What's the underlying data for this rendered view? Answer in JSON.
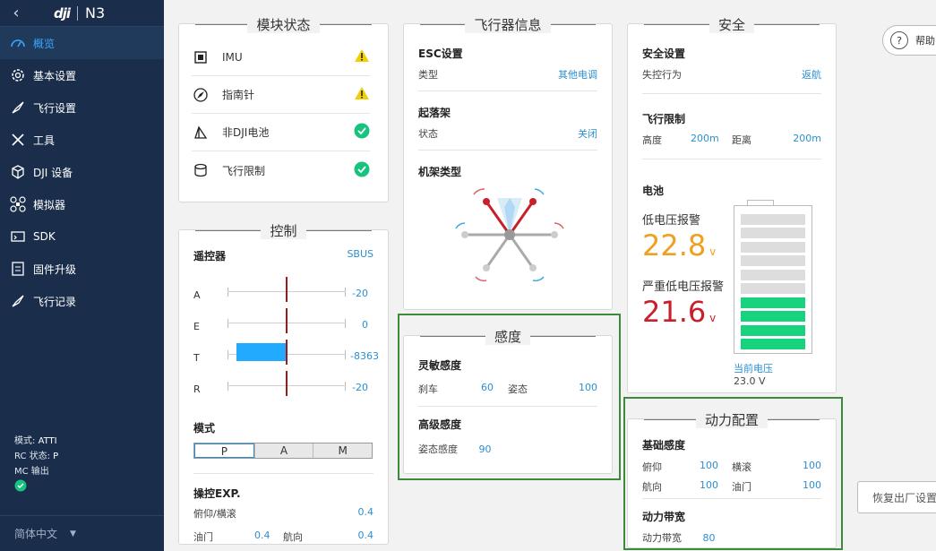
{
  "app": {
    "logo": "dji",
    "model": "N3",
    "back_glyph": "‹"
  },
  "nav": [
    {
      "label": "概览",
      "icon": "gauge-icon",
      "active": true
    },
    {
      "label": "基本设置",
      "icon": "gear-icon"
    },
    {
      "label": "飞行设置",
      "icon": "rocket-icon"
    },
    {
      "label": "工具",
      "icon": "tools-icon"
    },
    {
      "label": "DJI 设备",
      "icon": "cube-icon"
    },
    {
      "label": "模拟器",
      "icon": "drone-icon"
    },
    {
      "label": "SDK",
      "icon": "sdk-icon"
    },
    {
      "label": "固件升级",
      "icon": "firmware-icon"
    },
    {
      "label": "飞行记录",
      "icon": "log-icon"
    }
  ],
  "status": {
    "mode_label": "模式:",
    "mode_value": "ATTI",
    "rc_label": "RC 状态:",
    "rc_value": "P",
    "mc_label": "MC 输出"
  },
  "lang": {
    "label": "简体中文"
  },
  "module": {
    "title": "模块状态",
    "items": [
      {
        "label": "IMU",
        "state": "warn"
      },
      {
        "label": "指南针",
        "state": "warn"
      },
      {
        "label": "非DJI电池",
        "state": "ok"
      },
      {
        "label": "飞行限制",
        "state": "ok"
      }
    ]
  },
  "control": {
    "title": "控制",
    "rc_label": "遥控器",
    "rc_value": "SBUS",
    "channels": [
      {
        "name": "A",
        "value": "-20",
        "fill": 0
      },
      {
        "name": "E",
        "value": "0",
        "fill": 0
      },
      {
        "name": "T",
        "value": "-8363",
        "fill": -0.82
      },
      {
        "name": "R",
        "value": "-20",
        "fill": 0
      }
    ],
    "mode_label": "模式",
    "modes": [
      "P",
      "A",
      "M"
    ],
    "mode_selected": "P",
    "exp_label": "操控EXP.",
    "pitch_roll_label": "俯仰/横滚",
    "pitch_roll_value": "0.4",
    "throttle_label": "油门",
    "throttle_value": "0.4",
    "yaw_label": "航向",
    "yaw_value": "0.4"
  },
  "aircraft": {
    "title": "飞行器信息",
    "esc_label": "ESC设置",
    "type_label": "类型",
    "type_value": "其他电调",
    "gear_label": "起落架",
    "gear_state_label": "状态",
    "gear_state_value": "关闭",
    "frame_label": "机架类型"
  },
  "sensitivity": {
    "title": "感度",
    "basic_label": "灵敏感度",
    "brake_label": "刹车",
    "brake_value": "60",
    "attitude_label": "姿态",
    "attitude_value": "100",
    "advanced_label": "高级感度",
    "adv_attitude_label": "姿态感度",
    "adv_attitude_value": "90"
  },
  "safety": {
    "title": "安全",
    "settings_label": "安全设置",
    "failsafe_label": "失控行为",
    "failsafe_value": "返航",
    "limits_label": "飞行限制",
    "height_label": "高度",
    "height_value": "200m",
    "distance_label": "距离",
    "distance_value": "200m",
    "battery_label": "电池",
    "low_label": "低电压报警",
    "low_value": "22.8",
    "low_unit": "v",
    "crit_label": "严重低电压报警",
    "crit_value": "21.6",
    "crit_unit": "v",
    "current_label": "当前电压",
    "current_value": "23.0 V",
    "battery_cells_on": 4,
    "battery_cells_total": 10
  },
  "power": {
    "title": "动力配置",
    "basic_label": "基础感度",
    "pitch_label": "俯仰",
    "pitch_value": "100",
    "roll_label": "横滚",
    "roll_value": "100",
    "yaw_label": "航向",
    "yaw_value": "100",
    "throttle_label": "油门",
    "throttle_value": "100",
    "bandwidth_label": "动力带宽",
    "bw_label": "动力带宽",
    "bw_value": "80"
  },
  "help": {
    "label": "帮助"
  },
  "reset": {
    "label": "恢复出厂设置"
  },
  "colors": {
    "sidebar": "#1a2d4a",
    "accent": "#2c8fd0",
    "low_voltage": "#f0a020",
    "crit_voltage": "#c8202a",
    "ok": "#17c37e",
    "warn": "#f2d000",
    "border_highlight": "#3d8a3a"
  }
}
